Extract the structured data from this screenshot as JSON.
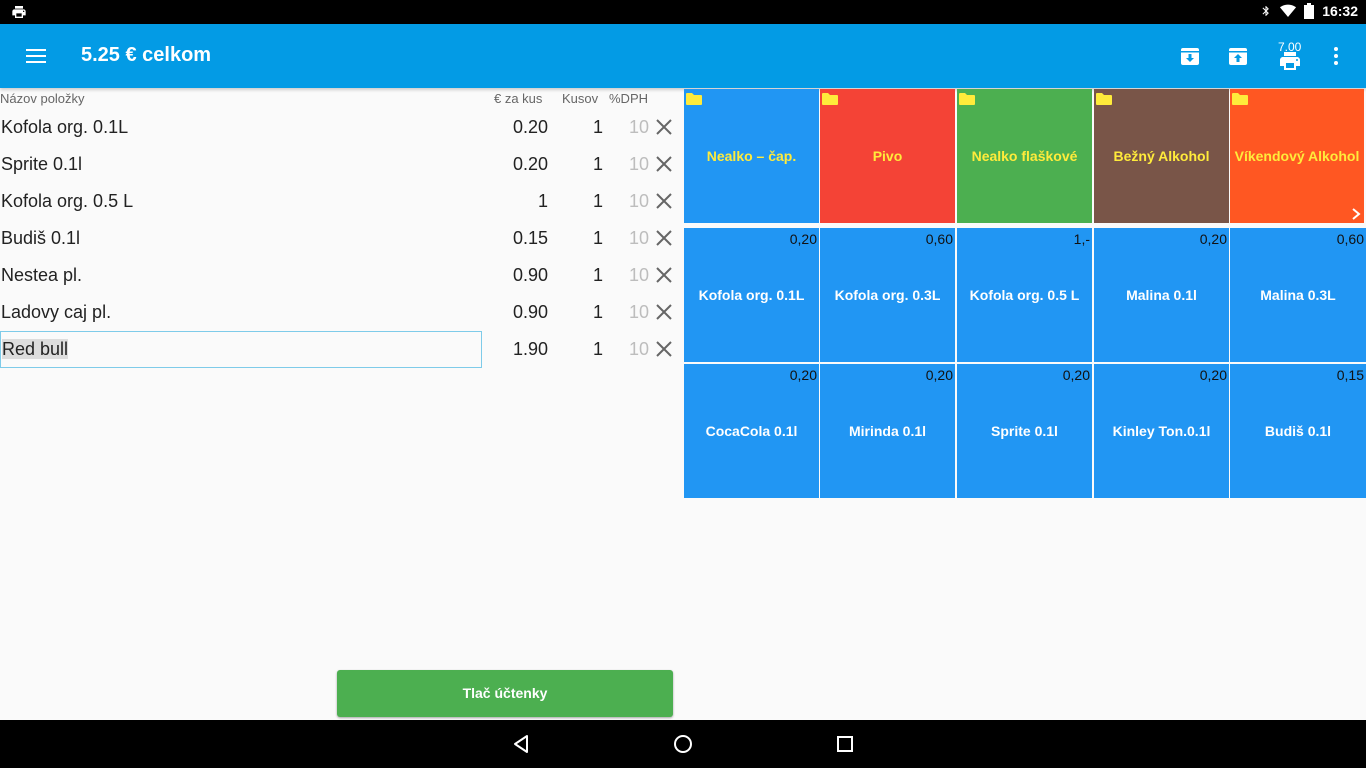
{
  "status_bar": {
    "time": "16:32"
  },
  "app_bar": {
    "title": "5.25 € celkom",
    "print_badge": "7.00"
  },
  "list": {
    "headers": {
      "name": "Názov položky",
      "price": "€ za kus",
      "qty": "Kusov",
      "vat": "%DPH"
    },
    "rows": [
      {
        "name": "Kofola org. 0.1L",
        "price": "0.20",
        "qty": "1",
        "vat": "10"
      },
      {
        "name": "Sprite 0.1l",
        "price": "0.20",
        "qty": "1",
        "vat": "10"
      },
      {
        "name": "Kofola org. 0.5 L",
        "price": "1",
        "qty": "1",
        "vat": "10"
      },
      {
        "name": "Budiš 0.1l",
        "price": "0.15",
        "qty": "1",
        "vat": "10"
      },
      {
        "name": "Nestea pl.",
        "price": "0.90",
        "qty": "1",
        "vat": "10"
      },
      {
        "name": "Ladovy caj pl.",
        "price": "0.90",
        "qty": "1",
        "vat": "10"
      },
      {
        "name": "Red bull",
        "price": "1.90",
        "qty": "1",
        "vat": "10"
      }
    ],
    "print_button": "Tlač účtenky"
  },
  "categories": [
    {
      "label": "Nealko – čap.",
      "color": "#2196f3"
    },
    {
      "label": "Pivo",
      "color": "#f44336"
    },
    {
      "label": "Nealko flaškové",
      "color": "#4caf50"
    },
    {
      "label": "Bežný Alkohol",
      "color": "#795548"
    },
    {
      "label": "Víkendový Alkohol",
      "color": "#ff5722"
    }
  ],
  "products": [
    {
      "label": "Kofola org. 0.1L",
      "price": "0,20"
    },
    {
      "label": "Kofola org. 0.3L",
      "price": "0,60"
    },
    {
      "label": "Kofola org. 0.5 L",
      "price": "1,-"
    },
    {
      "label": "Malina 0.1l",
      "price": "0,20"
    },
    {
      "label": "Malina 0.3L",
      "price": "0,60"
    },
    {
      "label": "CocaCola 0.1l",
      "price": "0,20"
    },
    {
      "label": "Mirinda 0.1l",
      "price": "0,20"
    },
    {
      "label": "Sprite 0.1l",
      "price": "0,20"
    },
    {
      "label": "Kinley Ton.0.1l",
      "price": "0,20"
    },
    {
      "label": "Budiš 0.1l",
      "price": "0,15"
    }
  ],
  "colors": {
    "product_tile": "#2196f3",
    "app_bar": "#039be5",
    "accent_button": "#4caf50"
  }
}
